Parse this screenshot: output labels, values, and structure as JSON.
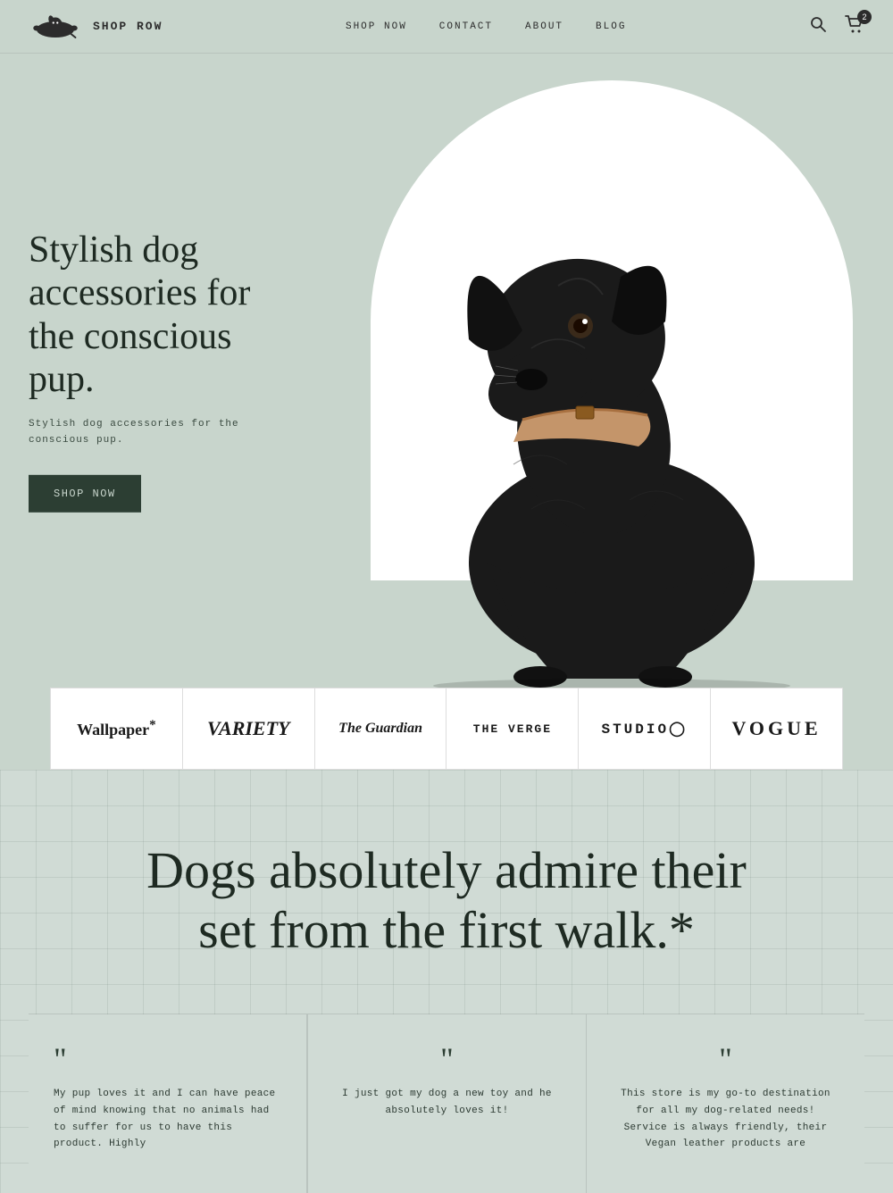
{
  "header": {
    "logo_text": "ShOP Row",
    "nav": [
      {
        "label": "SHOP NOW",
        "href": "#"
      },
      {
        "label": "CONTACT",
        "href": "#"
      },
      {
        "label": "ABOUT",
        "href": "#"
      },
      {
        "label": "BLOG",
        "href": "#"
      }
    ],
    "cart_count": "2"
  },
  "hero": {
    "headline": "Stylish dog accessories for the conscious pup.",
    "subtext": "Stylish dog accessories for the conscious pup.",
    "cta_label": "Shop Now"
  },
  "press": {
    "logos": [
      {
        "name": "Wallpaper*",
        "style": "wallpaper"
      },
      {
        "name": "VARIETY",
        "style": "variety"
      },
      {
        "name": "The Guardian",
        "style": "guardian"
      },
      {
        "name": "THE VERGE",
        "style": "verge"
      },
      {
        "name": "STUDIO◯",
        "style": "studio"
      },
      {
        "name": "VOGUE",
        "style": "vogue"
      }
    ]
  },
  "testimonial_section": {
    "headline": "Dogs absolutely admire their set from the first walk.*",
    "cards": [
      {
        "quote": "My pup loves it and I can have peace of mind knowing that no animals had to suffer for us to have this product. Highly"
      },
      {
        "quote": "I just got my dog a new toy and he absolutely loves it!"
      },
      {
        "quote": "This store is my go-to destination for all my dog-related needs! Service is always friendly, their Vegan leather products are"
      }
    ]
  }
}
